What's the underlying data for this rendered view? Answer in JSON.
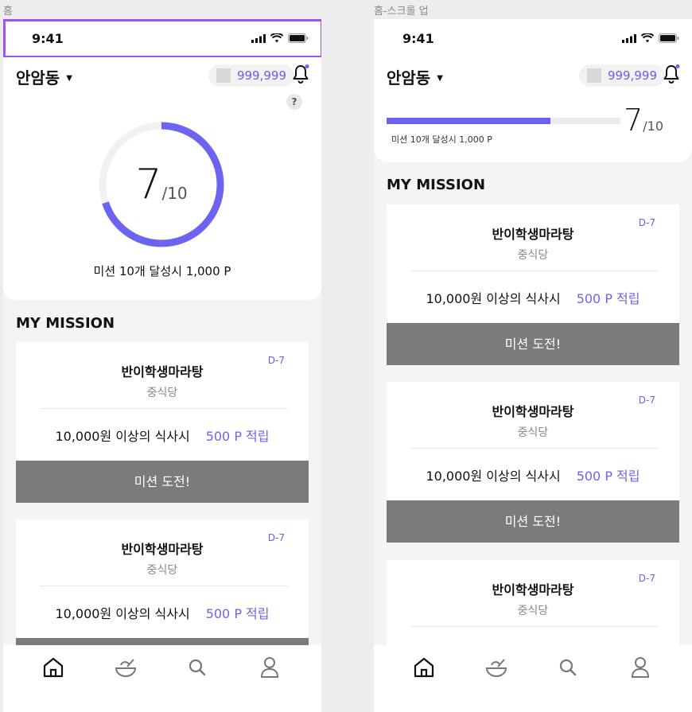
{
  "frames": {
    "home_label": "홈",
    "scroll_label": "홈-스크롤 업"
  },
  "status": {
    "time": "9:41"
  },
  "header": {
    "location": "안암동",
    "points": "999,999",
    "help": "?"
  },
  "progress": {
    "done": "7",
    "total": "/10",
    "fraction": 0.7,
    "reward": "미션 10개 달성시 1,000 P"
  },
  "section_title": "MY MISSION",
  "missions": [
    {
      "name": "반이학생마라탕",
      "category": "중식당",
      "dday": "D-7",
      "condition_strong": "10,000원 이상",
      "condition_rest": "의 식사시",
      "reward": "500 P 적립",
      "button": "미션 도전!"
    }
  ],
  "tabs": [
    "home-icon",
    "food-bowl-icon",
    "search-icon",
    "profile-icon"
  ],
  "colors": {
    "accent": "#6c63f0",
    "button": "#7b7b7b",
    "selection": "#9a55f2"
  }
}
